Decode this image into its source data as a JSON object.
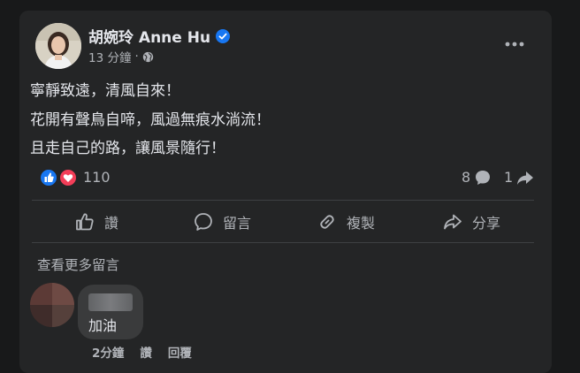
{
  "post": {
    "author": "胡婉玲 Anne Hu",
    "time": "13 分鐘",
    "privacy_icon": "globe-icon",
    "verified_icon": "verified-badge-icon",
    "body": [
      "寧靜致遠，清風自來！",
      "花開有聲鳥自啼，風過無痕水淌流！",
      "且走自己的路，讓風景隨行！"
    ],
    "reactions": {
      "icons": [
        "like-icon",
        "love-icon"
      ],
      "count": "110",
      "comments_count": "8",
      "shares_count": "1"
    }
  },
  "actions": {
    "like": "讚",
    "comment": "留言",
    "copy": "複製",
    "share": "分享"
  },
  "comments_section": {
    "more_comments": "查看更多留言",
    "comment": {
      "text": "加油",
      "time": "2分鐘",
      "like": "讚",
      "reply": "回覆"
    }
  },
  "colors": {
    "background": "#18191a",
    "card": "#242526",
    "primary_text": "#e4e6eb",
    "secondary_text": "#b0b3b8",
    "like_blue": "#1877f2",
    "love_red": "#f33e58"
  }
}
